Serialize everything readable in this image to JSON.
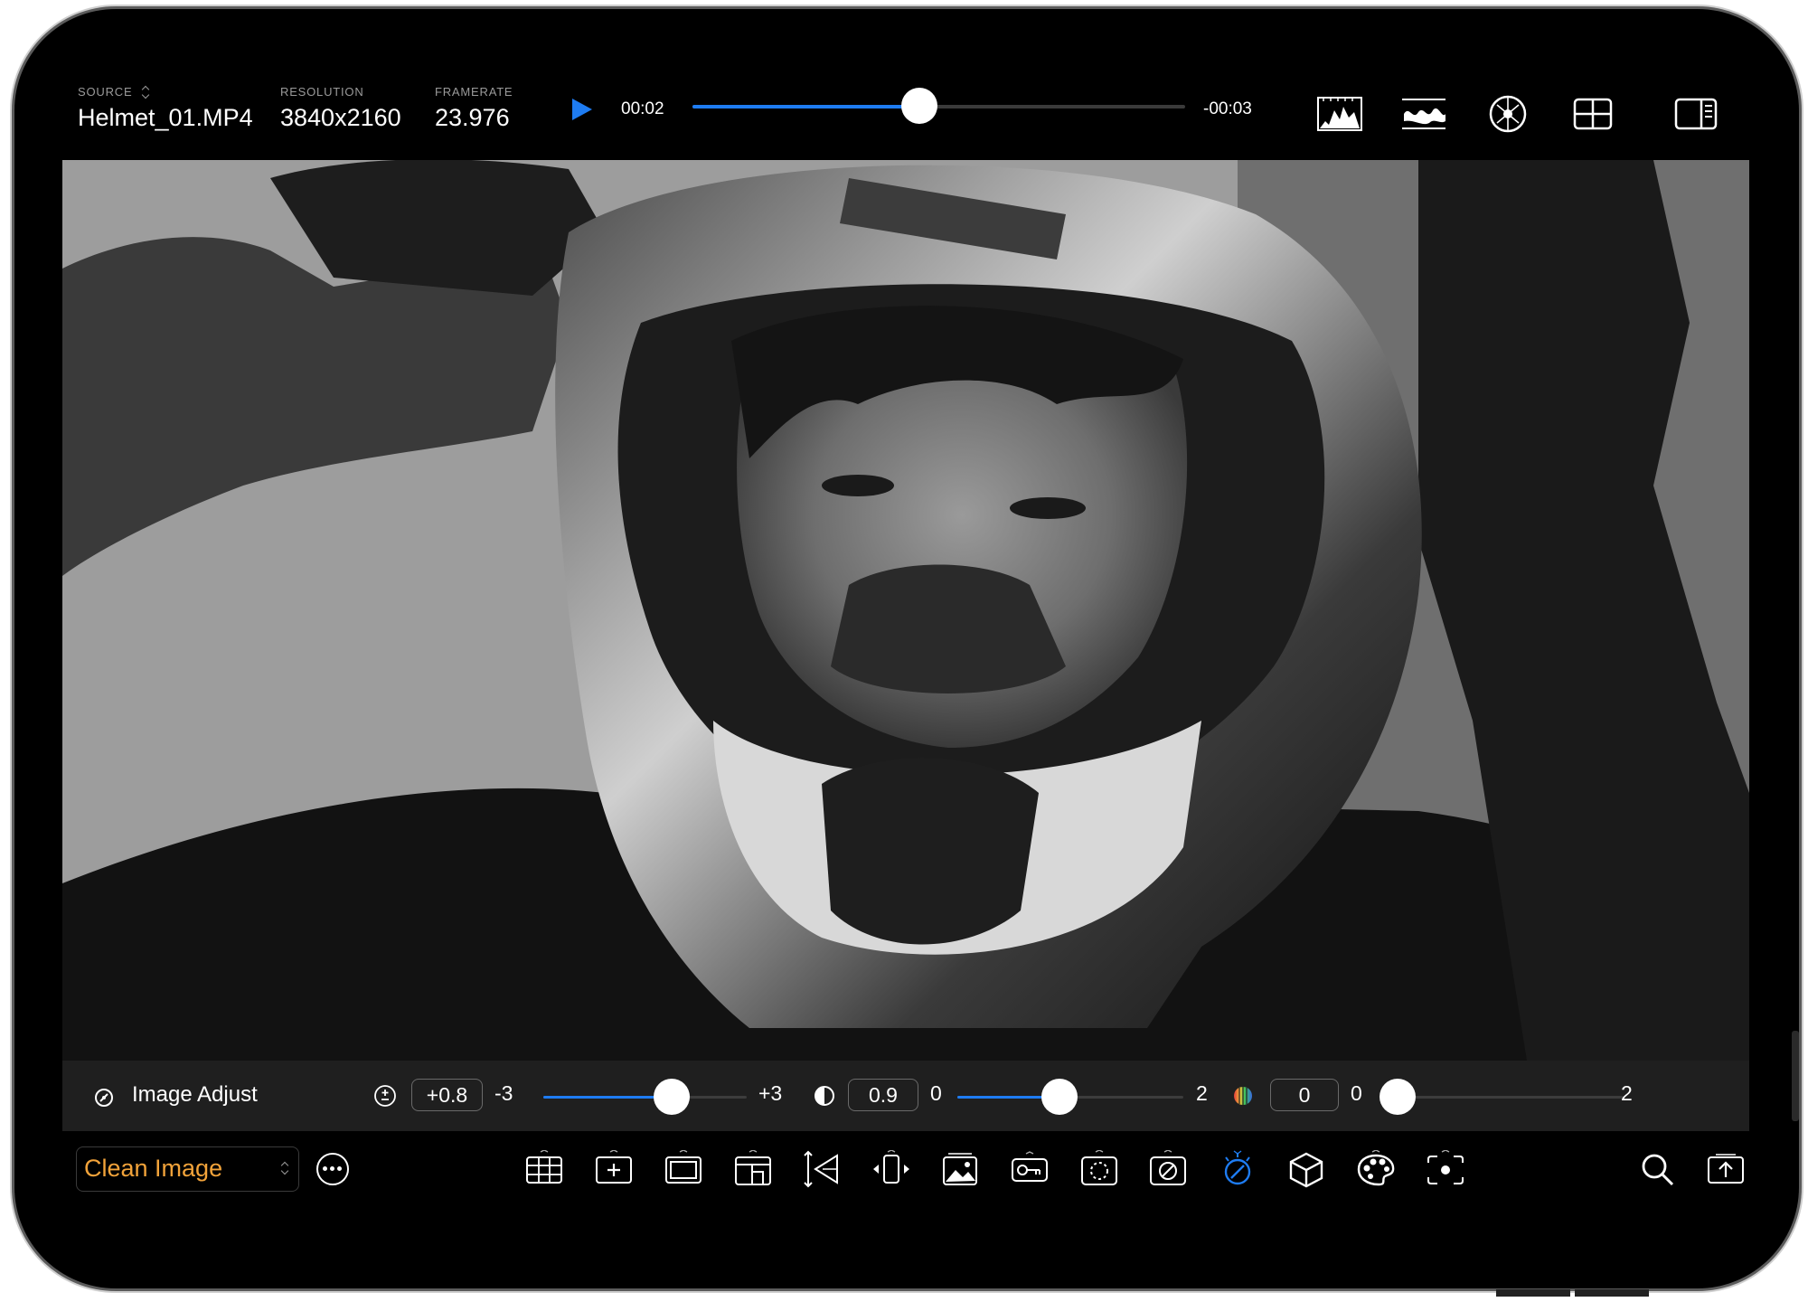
{
  "header": {
    "source_label": "SOURCE",
    "source_value": "Helmet_01.MP4",
    "resolution_label": "RESOLUTION",
    "resolution_value": "3840x2160",
    "framerate_label": "FRAMERATE",
    "framerate_value": "23.976"
  },
  "playback": {
    "elapsed": "00:02",
    "remaining": "-00:03",
    "progress": 0.46
  },
  "top_tools": [
    "histogram-icon",
    "waveform-icon",
    "vectorscope-icon",
    "grid-layout-icon",
    "sidebar-panel-icon"
  ],
  "adjust": {
    "title": "Image Adjust",
    "exposure": {
      "value": "+0.8",
      "min": "-3",
      "max": "+3",
      "level": 0.6333
    },
    "contrast": {
      "value": "0.9",
      "min": "0",
      "max": "2",
      "level": 0.45
    },
    "saturation": {
      "value": "0",
      "min": "0",
      "max": "2",
      "level": 0.0
    }
  },
  "preset": {
    "label": "Clean Image"
  },
  "bottom_tools": [
    "grid-overlay-icon",
    "center-marker-icon",
    "frame-guide-icon",
    "safe-area-icon",
    "anamorphic-icon",
    "flip-icon",
    "image-overlay-icon",
    "false-color-icon",
    "focus-peaking-icon",
    "zebra-icon",
    "image-adjust-icon",
    "lut-cube-icon",
    "color-palette-icon",
    "spot-meter-icon"
  ],
  "right_tools": [
    "search-icon",
    "export-icon"
  ],
  "colors": {
    "accent": "#1e7cf2",
    "preset_text": "#f2a33a",
    "background": "#000000"
  }
}
